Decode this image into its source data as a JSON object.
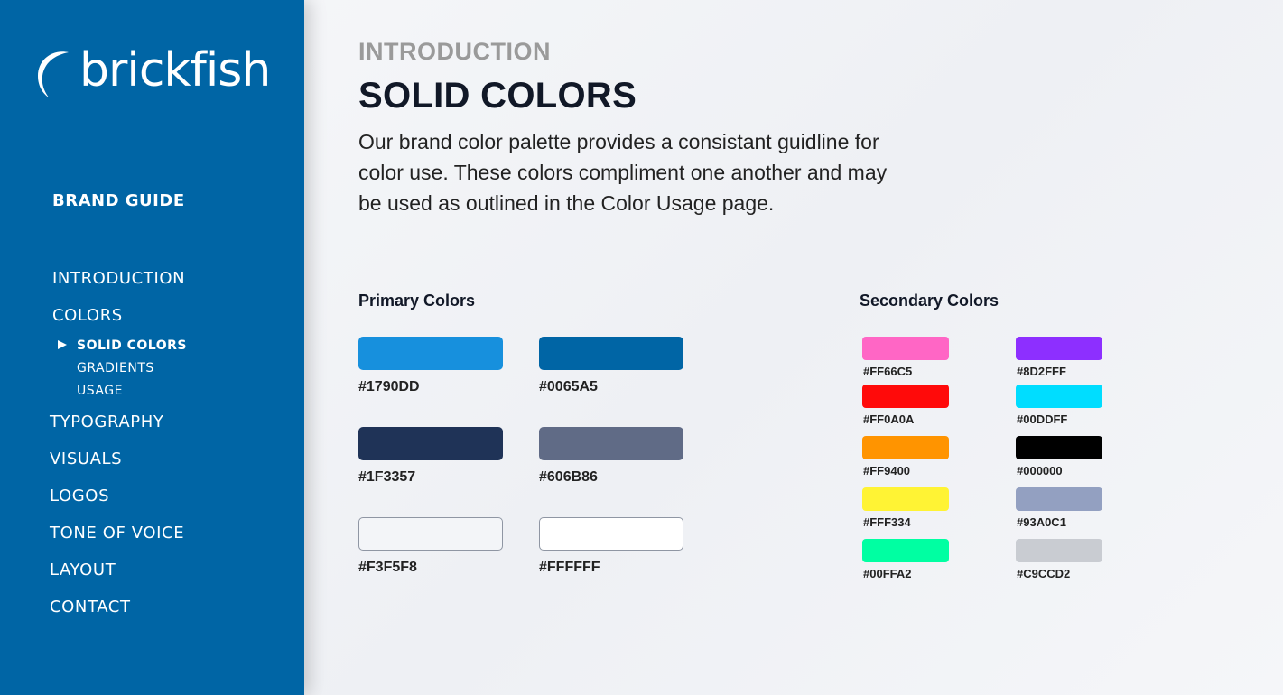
{
  "sidebar": {
    "logo_text": "brickfish",
    "section_title": "BRAND GUIDE",
    "nav": {
      "introduction": "INTRODUCTION",
      "colors": "COLORS",
      "typography": "TYPOGRAPHY",
      "visuals": "VISUALS",
      "logos": "LOGOS",
      "tone": "TONE OF VOICE",
      "layout": "LAYOUT",
      "contact": "CONTACT"
    },
    "sub": {
      "solid": "SOLID COLORS",
      "gradients": "GRADIENTS",
      "usage": "USAGE"
    }
  },
  "main": {
    "eyebrow": "INTRODUCTION",
    "title": "SOLID COLORS",
    "description": "Our brand color palette provides a consistant guidline for color use. These colors compliment one another and may be used as outlined in the Color Usage page.",
    "primary_label": "Primary Colors",
    "secondary_label": "Secondary Colors",
    "primary": [
      {
        "hex": "#1790DD",
        "color": "#1790DD"
      },
      {
        "hex": "#0065A5",
        "color": "#0065A5"
      },
      {
        "hex": "#1F3357",
        "color": "#1F3357"
      },
      {
        "hex": "#606B86",
        "color": "#606B86"
      },
      {
        "hex": "#F3F5F8",
        "color": "#F3F5F8"
      },
      {
        "hex": "#FFFFFF",
        "color": "#FFFFFF"
      }
    ],
    "secondary": [
      {
        "hex": "#FF66C5",
        "color": "#FF66C5"
      },
      {
        "hex": "#8D2FFF",
        "color": "#8D2FFF"
      },
      {
        "hex": "#FF0A0A",
        "color": "#FF0A0A"
      },
      {
        "hex": "#00DDFF",
        "color": "#00DDFF"
      },
      {
        "hex": "#FF9400",
        "color": "#FF9400"
      },
      {
        "hex": "#000000",
        "color": "#000000"
      },
      {
        "hex": "#FFF334",
        "color": "#FFF334"
      },
      {
        "hex": "#93A0C1",
        "color": "#93A0C1"
      },
      {
        "hex": "#00FFA2",
        "color": "#00FFA2"
      },
      {
        "hex": "#C9CCD2",
        "color": "#C9CCD2"
      }
    ]
  },
  "colors": {
    "sidebar_bg": "#0065A5",
    "heading": "#111827",
    "eyebrow": "#9A9A9A"
  }
}
